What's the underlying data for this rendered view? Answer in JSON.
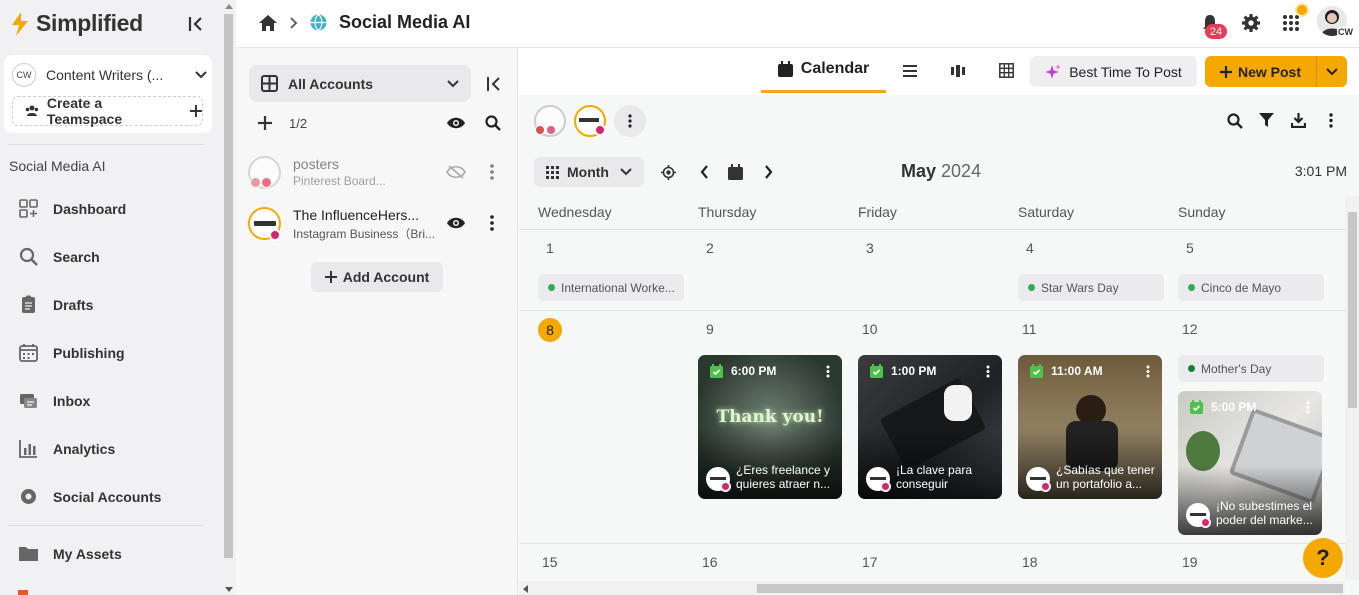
{
  "sidebar": {
    "logo": "Simplified",
    "workspace": {
      "initials": "CW",
      "name": "Content Writers (..."
    },
    "teamspace_label": "Create a Teamspace",
    "section_title": "Social Media AI",
    "items": [
      {
        "label": "Dashboard",
        "icon": "dashboard-icon"
      },
      {
        "label": "Search",
        "icon": "search-icon"
      },
      {
        "label": "Drafts",
        "icon": "drafts-icon"
      },
      {
        "label": "Publishing",
        "icon": "calendar-icon"
      },
      {
        "label": "Inbox",
        "icon": "inbox-icon"
      },
      {
        "label": "Analytics",
        "icon": "analytics-icon"
      },
      {
        "label": "Social Accounts",
        "icon": "globe-icon"
      },
      {
        "label": "My Assets",
        "icon": "folder-icon"
      }
    ]
  },
  "header": {
    "title": "Social Media AI",
    "notification_count": "24",
    "user_initials": "CW"
  },
  "accounts_panel": {
    "selector_label": "All Accounts",
    "count": "1/2",
    "accounts": [
      {
        "name": "posters",
        "sub": "Pinterest Board...",
        "muted": true
      },
      {
        "name": "The InfluenceHers...",
        "sub": "Instagram Business（Bri...",
        "muted": false
      }
    ],
    "add_account_label": "Add Account"
  },
  "toolbar": {
    "active_tab": "Calendar",
    "best_time_label": "Best Time To Post",
    "new_post_label": "New Post"
  },
  "calendar": {
    "view_label": "Month",
    "month": "May",
    "year": "2024",
    "time": "3:01 PM",
    "weekdays": [
      "Wednesday",
      "Thursday",
      "Friday",
      "Saturday",
      "Sunday"
    ],
    "week1": {
      "days": [
        "1",
        "2",
        "3",
        "4",
        "5"
      ],
      "holidays": [
        "International Worke...",
        "",
        "",
        "Star Wars Day",
        "Cinco de Mayo"
      ]
    },
    "week2": {
      "days": [
        "8",
        "9",
        "10",
        "11",
        "12"
      ],
      "today": "8",
      "sunday_holiday": "Mother's Day",
      "posts": [
        {
          "time": "6:00 PM",
          "caption": "¿Eres freelance y quieres atraer n...",
          "image_text": "Thank you!"
        },
        {
          "time": "1:00 PM",
          "caption": "¡La clave para conseguir clientes..."
        },
        {
          "time": "11:00 AM",
          "caption": "¿Sabías que tener un portafolio a..."
        },
        {
          "time": "5:00 PM",
          "caption": "¡No subestimes el poder del marke..."
        }
      ]
    },
    "week3": {
      "days": [
        "15",
        "16",
        "17",
        "18",
        "19"
      ]
    }
  },
  "help_label": "?",
  "colors": {
    "accent": "#f5a800",
    "badge": "#e83b55",
    "instagram": "#d6246e"
  }
}
